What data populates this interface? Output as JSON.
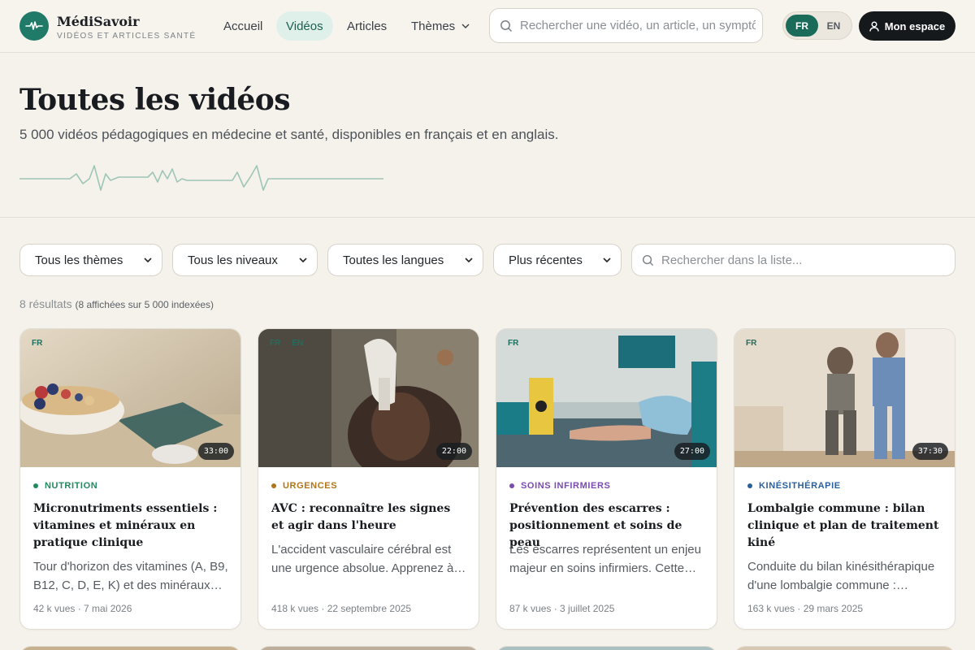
{
  "brand": {
    "name": "MédiSavoir",
    "tagline": "VIDÉOS ET ARTICLES SANTÉ"
  },
  "nav": {
    "items": [
      {
        "label": "Accueil",
        "active": false
      },
      {
        "label": "Vidéos",
        "active": true
      },
      {
        "label": "Articles",
        "active": false
      },
      {
        "label": "Thèmes",
        "active": false,
        "dropdown": true
      }
    ]
  },
  "search": {
    "placeholder": "Rechercher une vidéo, un article, un symptôme…"
  },
  "language": {
    "options": [
      "FR",
      "EN"
    ],
    "selected": "FR"
  },
  "account": {
    "label": "Mon espace"
  },
  "hero": {
    "title": "Toutes les vidéos",
    "subtitle": "5 000 vidéos pédagogiques en médecine et santé, disponibles en français et en anglais."
  },
  "filters": {
    "theme": "Tous les thèmes",
    "level": "Tous les niveaux",
    "language": "Toutes les langues",
    "sort": "Plus récentes",
    "search_placeholder": "Rechercher dans la liste..."
  },
  "results": {
    "count": "8 résultats",
    "detail": "(8 affichées sur 5 000 indexées)"
  },
  "videos": [
    {
      "langs": [
        "FR"
      ],
      "duration": "33:00",
      "category": "NUTRITION",
      "category_color": "#1f8a5e",
      "title": "Micronutriments essentiels : vitamines et minéraux en pratique clinique",
      "description": "Tour d'horizon des vitamines (A, B9, B12, C, D, E, K) et des minéraux essentiels en pratique clinique.",
      "meta": "42 k vues · 7 mai 2026"
    },
    {
      "langs": [
        "FR",
        "EN"
      ],
      "duration": "22:00",
      "category": "URGENCES",
      "category_color": "#b0751b",
      "title": "AVC : reconnaître les signes et agir dans l'heure",
      "description": "L'accident vasculaire cérébral est une urgence absolue. Apprenez à reconnaître les signes.",
      "meta": "418 k vues · 22 septembre 2025"
    },
    {
      "langs": [
        "FR"
      ],
      "duration": "27:00",
      "category": "SOINS INFIRMIERS",
      "category_color": "#7a4bb0",
      "title": "Prévention des escarres : positionnement et soins de peau",
      "description": "Les escarres représentent un enjeu majeur en soins infirmiers. Cette vidéo détaille la prévention.",
      "meta": "87 k vues · 3 juillet 2025"
    },
    {
      "langs": [
        "FR"
      ],
      "duration": "37:30",
      "category": "KINÉSITHÉRAPIE",
      "category_color": "#2a5f9e",
      "title": "Lombalgie commune : bilan clinique et plan de traitement kiné",
      "description": "Conduite du bilan kinésithérapique d'une lombalgie commune : interrogatoire et examen.",
      "meta": "163 k vues · 29 mars 2025"
    }
  ],
  "colors": {
    "accent": "#1b6b5b",
    "accent_light": "#dff0ea",
    "dark": "#16191c",
    "background": "#f5f2ec"
  }
}
